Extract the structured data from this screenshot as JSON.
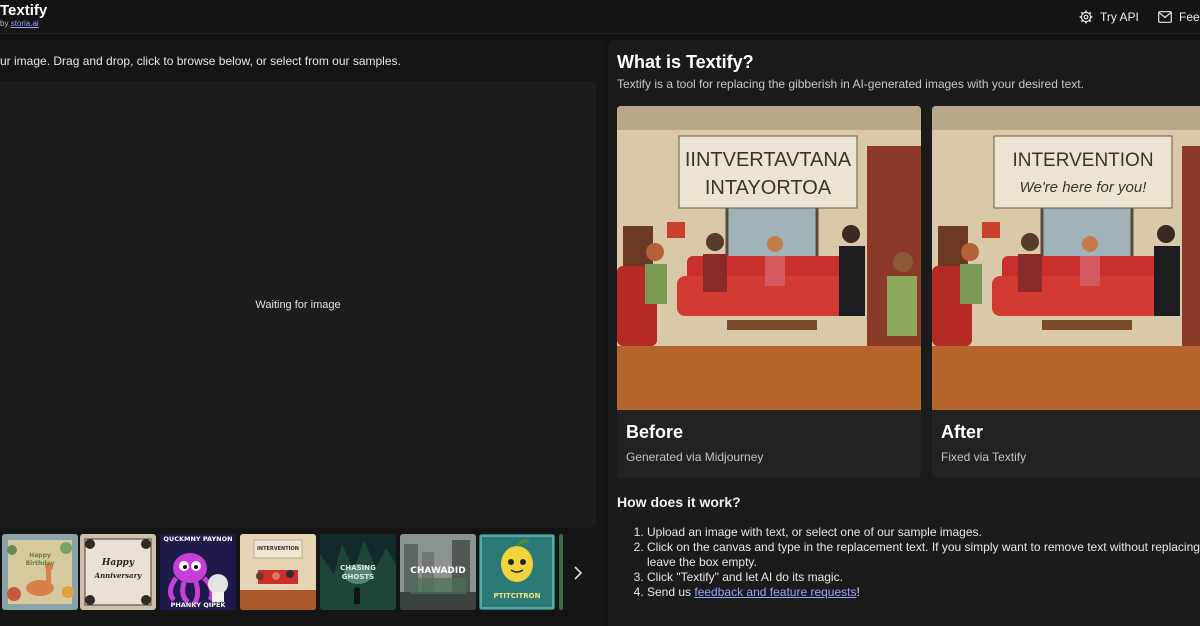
{
  "header": {
    "app_title": "Textify",
    "by_prefix": "by",
    "by_link": "storia.ai",
    "try_api_label": "Try API",
    "feedback_label": "Feedback"
  },
  "left": {
    "instructions": "ur image. Drag and drop, click to browse below, or select from our samples.",
    "canvas_placeholder": "Waiting for image",
    "samples": [
      {
        "name": "birthday-card",
        "text_top": "Happy",
        "text_bottom": "Birthday"
      },
      {
        "name": "anniversary-card",
        "text_top": "Happy",
        "text_bottom": "Anniversary"
      },
      {
        "name": "octopus-poster",
        "text_top": "QUCKMNY PAYNON",
        "text_bottom": "PHANKY QIPEK"
      },
      {
        "name": "intervention-scene",
        "text_top": "INTERVENTION",
        "text_bottom": ""
      },
      {
        "name": "ghost-poster",
        "text_top": "CHASING",
        "text_bottom": "GHOSTS"
      },
      {
        "name": "city-poster",
        "text_top": "CHAWADID",
        "text_bottom": ""
      },
      {
        "name": "lemon-poster",
        "text_top": "PTITCITRON",
        "text_bottom": ""
      }
    ]
  },
  "right": {
    "title": "What is Textify?",
    "description": "Textify is a tool for replacing the gibberish in AI-generated images with your desired text.",
    "before": {
      "banner_line1": "IINTVERTAVTANA",
      "banner_line2": "INTAYORTOA",
      "title": "Before",
      "subtitle": "Generated via Midjourney"
    },
    "after": {
      "banner_line1": "INTERVENTION",
      "banner_line2": "We're here for you!",
      "title": "After",
      "subtitle": "Fixed via Textify"
    },
    "how_title": "How does it work?",
    "steps": [
      "Upload an image with text, or select one of our sample images.",
      "Click on the canvas and type in the replacement text. If you simply want to remove text without replacing it,",
      "leave the box empty.",
      "Click \"Textify\" and let AI do its magic."
    ],
    "step4_prefix": "Send us ",
    "step4_link": "feedback and feature requests",
    "step4_suffix": "!"
  },
  "colors": {
    "background": "#111111",
    "panel": "#1b1b1b",
    "link": "#9aa2ff"
  }
}
